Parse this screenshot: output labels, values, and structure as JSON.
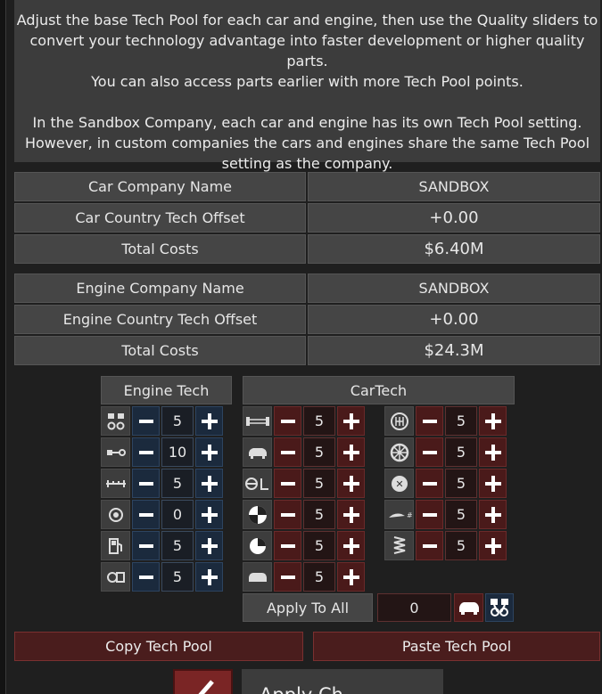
{
  "description": {
    "lines1": [
      "Adjust the base Tech Pool for each car and engine, then use the Quality sliders to",
      "convert your technology advantage into faster development or higher quality parts.",
      "You can also access parts earlier with more Tech Pool points."
    ],
    "lines2": [
      "In the Sandbox Company, each car and engine has its own Tech Pool setting.",
      "However, in custom companies the cars and engines share the same Tech Pool",
      "setting as the company."
    ]
  },
  "car_info": [
    {
      "label": "Car Company Name",
      "value": "SANDBOX"
    },
    {
      "label": "Car Country Tech Offset",
      "value": "+0.00"
    },
    {
      "label": "Total Costs",
      "value": "$6.40M"
    }
  ],
  "engine_info": [
    {
      "label": "Engine Company Name",
      "value": "SANDBOX"
    },
    {
      "label": "Engine Country Tech Offset",
      "value": "+0.00"
    },
    {
      "label": "Total Costs",
      "value": "$24.3M"
    }
  ],
  "engine_tech": {
    "header": "Engine Tech",
    "rows": [
      {
        "icon": "pistons-icon",
        "value": "5"
      },
      {
        "icon": "crankshaft-icon",
        "value": "10"
      },
      {
        "icon": "camshaft-icon",
        "value": "5"
      },
      {
        "icon": "turbo-icon",
        "value": "0"
      },
      {
        "icon": "fuel-pump-icon",
        "value": "5"
      },
      {
        "icon": "exhaust-icon",
        "value": "5"
      }
    ]
  },
  "car_tech": {
    "header": "CarTech",
    "col1": [
      {
        "icon": "chassis-icon",
        "value": "5"
      },
      {
        "icon": "car-body-icon",
        "value": "5"
      },
      {
        "icon": "interior-icon",
        "value": "5"
      },
      {
        "icon": "safety-icon",
        "value": "5"
      },
      {
        "icon": "quality-icon",
        "value": "5"
      },
      {
        "icon": "car-front-icon",
        "value": "5"
      }
    ],
    "col2": [
      {
        "icon": "gearbox-icon",
        "value": "5"
      },
      {
        "icon": "wheel-icon",
        "value": "5"
      },
      {
        "icon": "brake-icon",
        "value": "5"
      },
      {
        "icon": "aero-icon",
        "value": "5"
      },
      {
        "icon": "suspension-icon",
        "value": "5"
      }
    ]
  },
  "apply_all": {
    "label": "Apply To All",
    "value": "0"
  },
  "buttons": {
    "copy": "Copy Tech Pool",
    "paste": "Paste Tech Pool",
    "apply_changes": "Apply Ch"
  },
  "colors": {
    "engine_accent": "#1b2a3d",
    "car_accent": "#4a1a1a"
  }
}
